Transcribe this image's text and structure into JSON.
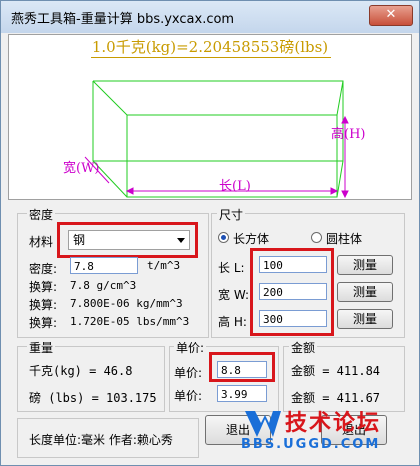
{
  "window": {
    "title": "燕秀工具箱-重量计算  bbs.yxcax.com",
    "close_label": "✕"
  },
  "diagram": {
    "formula": "1.0千克(kg)=2.20458553磅(lbs)",
    "height_label": "高(H)",
    "width_label": "宽(W)",
    "length_label": "长(L)"
  },
  "density_group": {
    "title": "密度",
    "material_label": "材料",
    "material_value": "钢",
    "density_label": "密度:",
    "density_value": "7.8",
    "density_unit": "t/m^3",
    "conv1_label": "换算:",
    "conv1_value": "7.8 g/cm^3",
    "conv2_label": "换算:",
    "conv2_value": "7.800E-06 kg/mm^3",
    "conv3_label": "换算:",
    "conv3_value": "1.720E-05 lbs/mm^3"
  },
  "size_group": {
    "title": "尺寸",
    "shape_cuboid": "长方体",
    "shape_cylinder": "圆柱体",
    "selected_shape": "cuboid",
    "length_label": "长  L:",
    "length_value": "100",
    "width_label": "宽  W:",
    "width_value": "200",
    "height_label": "高  H:",
    "height_value": "300",
    "measure_label": "测量"
  },
  "weight_group": {
    "title": "重量",
    "kg_text": "千克(kg) = 46.8",
    "lbs_text": "磅 (lbs) = 103.175"
  },
  "price_group": {
    "price1_label": "单价:",
    "price2_label": "单价:",
    "price3_label": "单价:",
    "price2_value": "8.8",
    "price3_value": "3.99"
  },
  "amount_group": {
    "title": "金额",
    "amount1_text": "金额 = 411.84",
    "amount2_text": "金额 = 411.67"
  },
  "footer": {
    "info_text": "长度单位:毫米  作者:赖心秀",
    "exit_label": "退出",
    "calc_label": "退出"
  },
  "watermark": {
    "text": "技术论坛",
    "url": "BBS.UGGD.COM"
  },
  "colors": {
    "highlight": "#d8161b",
    "box_lines": "#22cc22",
    "dimension": "#cc00cc",
    "formula": "#c89b00"
  }
}
